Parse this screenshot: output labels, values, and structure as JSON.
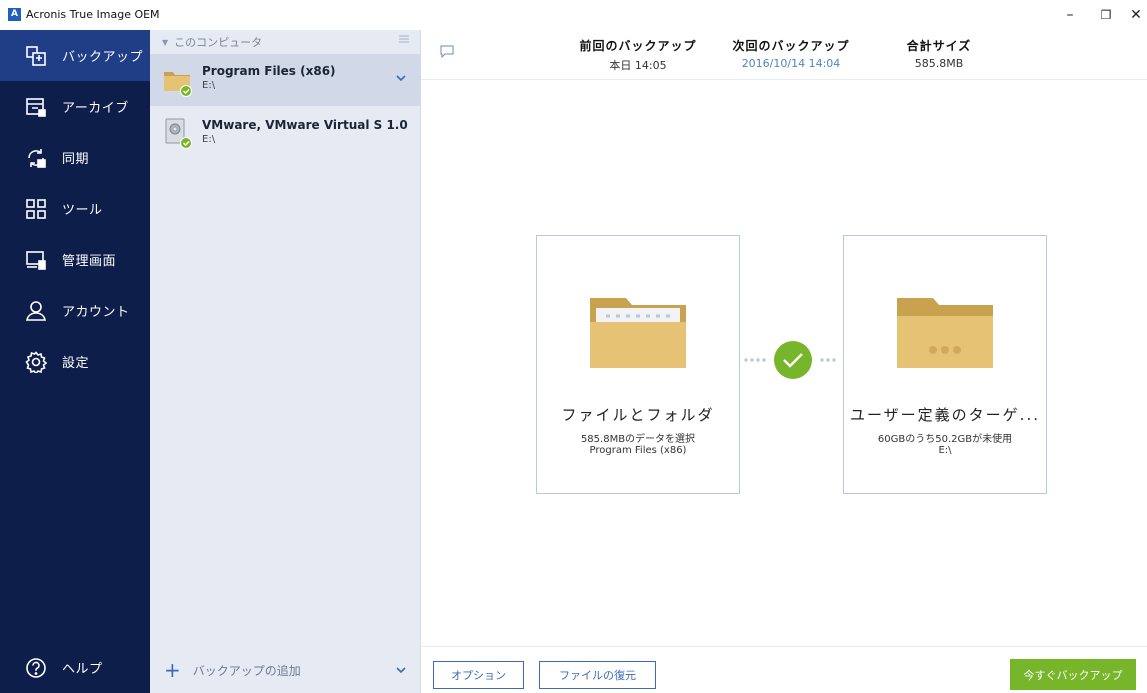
{
  "window": {
    "title": "Acronis True Image OEM",
    "app_icon_letter": "A",
    "controls": {
      "minimize": "–",
      "restore": "❐",
      "close": "✕"
    }
  },
  "nav": {
    "items": [
      {
        "label": "バックアップ",
        "icon": "backup-icon",
        "active": true
      },
      {
        "label": "アーカイブ",
        "icon": "archive-icon",
        "active": false
      },
      {
        "label": "同期",
        "icon": "sync-icon",
        "active": false
      },
      {
        "label": "ツール",
        "icon": "tools-icon",
        "active": false
      },
      {
        "label": "管理画面",
        "icon": "dashboard-icon",
        "active": false
      },
      {
        "label": "アカウント",
        "icon": "account-icon",
        "active": false
      },
      {
        "label": "設定",
        "icon": "settings-icon",
        "active": false
      }
    ],
    "help": {
      "label": "ヘルプ",
      "icon": "help-icon"
    }
  },
  "backup_list": {
    "header": "このコンピュータ",
    "items": [
      {
        "name": "Program Files (x86)",
        "destination": "E:\\",
        "status": "ok",
        "active": true
      },
      {
        "name": "VMware, VMware Virtual S 1.0",
        "destination": "E:\\",
        "status": "ok",
        "active": false
      }
    ],
    "add_label": "バックアップの追加"
  },
  "info": {
    "last_backup": {
      "label": "前回のバックアップ",
      "value": "本日 14:05"
    },
    "next_backup": {
      "label": "次回のバックアップ",
      "value": "2016/10/14 14:04"
    },
    "total_size": {
      "label": "合計サイズ",
      "value": "585.8MB"
    }
  },
  "source_card": {
    "title": "ファイルとフォルダ",
    "line2": "585.8MBのデータを選択",
    "line3": "Program Files (x86)"
  },
  "target_card": {
    "title": "ユーザー定義のターゲ...",
    "line2": "60GBのうち50.2GBが未使用",
    "line3": "E:\\"
  },
  "footer": {
    "options_label": "オプション",
    "restore_label": "ファイルの復元",
    "backup_now_label": "今すぐバックアップ"
  },
  "colors": {
    "nav_bg": "#0d1e4a",
    "nav_active": "#1f3e86",
    "list_bg": "#e6ebf3",
    "accent": "#3b6bb5",
    "success": "#77b52a",
    "folder": "#e6c274"
  }
}
